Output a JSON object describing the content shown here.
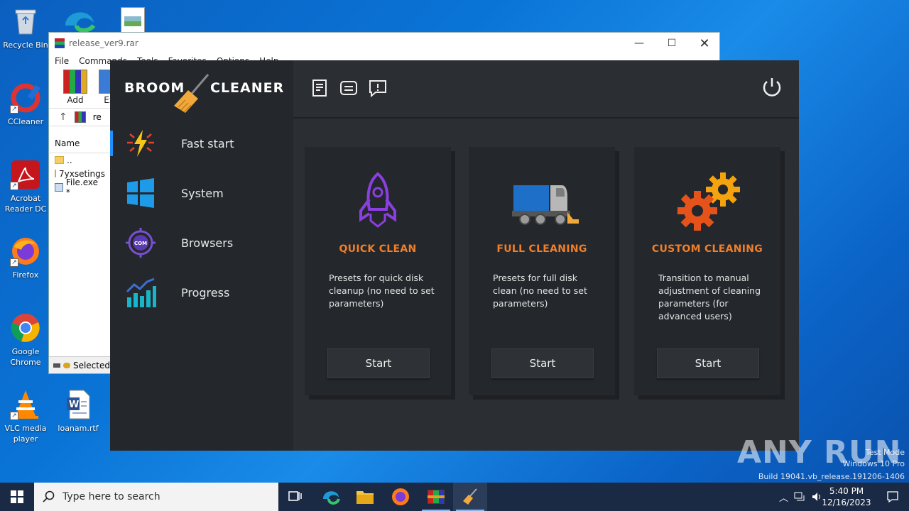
{
  "desktop": {
    "icons": [
      {
        "label": "Recycle Bin"
      },
      {
        "label": "CCleaner"
      },
      {
        "label": "Acrobat Reader DC"
      },
      {
        "label": "Firefox"
      },
      {
        "label": "Google Chrome"
      },
      {
        "label": "VLC media player"
      },
      {
        "label": "loanam.rtf"
      }
    ]
  },
  "winrar": {
    "title": "release_ver9.rar",
    "menu": [
      "File",
      "Commands",
      "Tools",
      "Favorites",
      "Options",
      "Help"
    ],
    "toolbar": [
      {
        "label": "Add"
      },
      {
        "label": "Ext"
      }
    ],
    "address": "re",
    "column_name": "Name",
    "files": [
      "..",
      "7yxsetings",
      "File.exe *"
    ],
    "status": "Selected"
  },
  "broom": {
    "logo_left": "BROOM",
    "logo_right": "CLEANER",
    "nav": [
      {
        "label": "Fast start",
        "icon": "lightning-icon"
      },
      {
        "label": "System",
        "icon": "windows-icon"
      },
      {
        "label": "Browsers",
        "icon": "com-target-icon"
      },
      {
        "label": "Progress",
        "icon": "bar-chart-icon"
      }
    ],
    "cards": [
      {
        "title": "QUICK CLEAN",
        "desc": "Presets for quick disk cleanup (no need to set parameters)",
        "button": "Start",
        "icon": "rocket-icon"
      },
      {
        "title": "FULL CLEANING",
        "desc": "Presets for full disk clean (no need to set parameters)",
        "button": "Start",
        "icon": "sweeper-truck-icon"
      },
      {
        "title": "CUSTOM CLEANING",
        "desc": "Transition to manual adjustment of cleaning parameters (for advanced users)",
        "button": "Start",
        "icon": "gears-icon"
      }
    ],
    "colors": {
      "accent": "#f07f2a",
      "active": "#1e90ff",
      "bg": "#2b2e33",
      "sidebar": "#24272b"
    }
  },
  "watermark": {
    "brand": "ANY RUN",
    "line1": "Test Mode",
    "line2": "Windows 10 Pro",
    "line3": "Build 19041.vb_release.191206-1406"
  },
  "taskbar": {
    "search_placeholder": "Type here to search",
    "time": "5:40 PM",
    "date": "12/16/2023"
  }
}
